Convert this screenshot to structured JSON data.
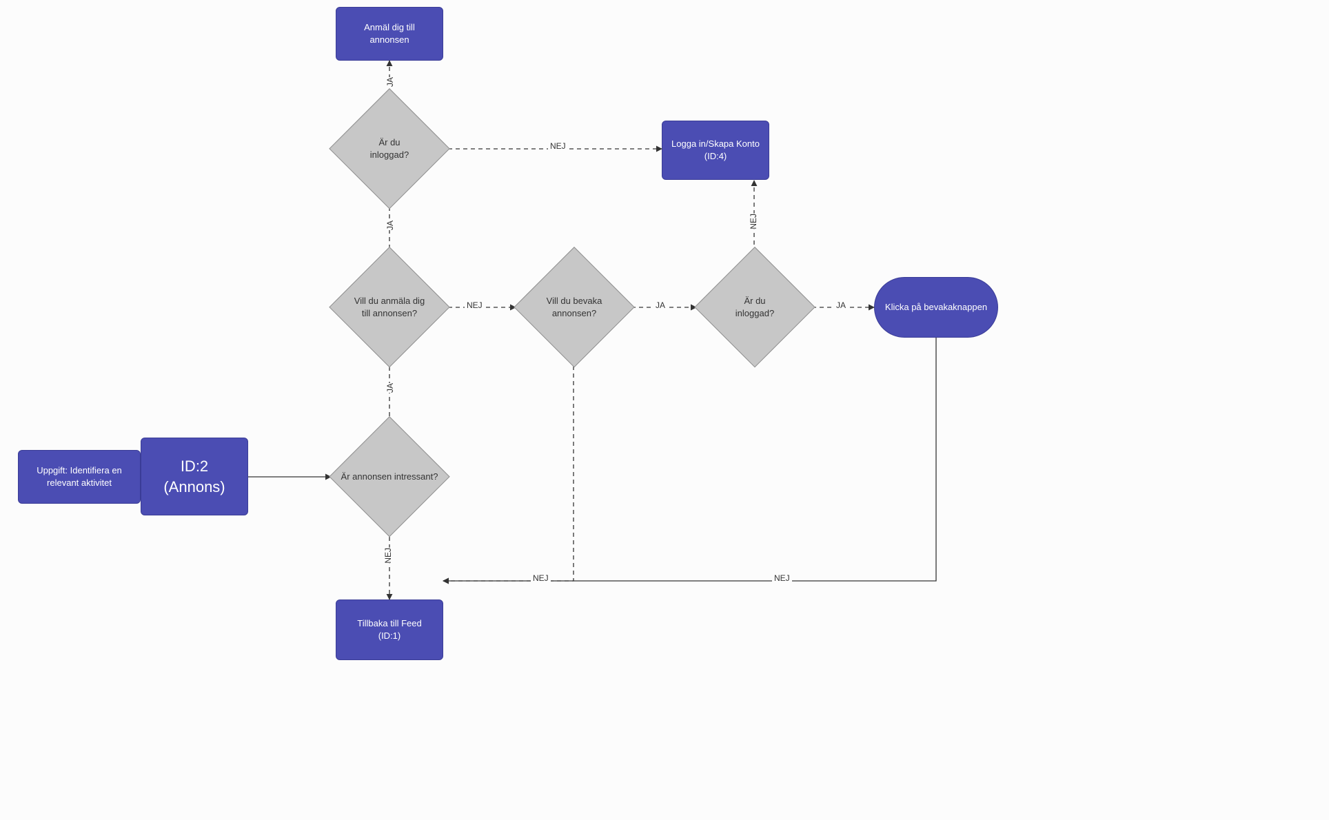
{
  "colors": {
    "node": "#4b4db3",
    "decision": "#c7c7c7",
    "text_on_node": "#ffffff",
    "text_on_decision": "#333333"
  },
  "labels": {
    "ja": "JA",
    "nej": "NEJ"
  },
  "nodes": {
    "task": {
      "text": "Uppgift: Identifiera en relevant aktivitet"
    },
    "id2": {
      "text": "ID:2\n(Annons)"
    },
    "d_interest": {
      "text": "Är annonsen intressant?"
    },
    "d_apply": {
      "text": "Vill du anmäla dig till annonsen?"
    },
    "d_follow": {
      "text": "Vill du bevaka annonsen?"
    },
    "d_login1": {
      "text": "Är du inloggad?"
    },
    "d_login2": {
      "text": "Är du inloggad?"
    },
    "p_apply": {
      "text": "Anmäl dig till annonsen"
    },
    "p_login": {
      "text": "Logga in/Skapa Konto\n(ID:4)"
    },
    "p_back": {
      "text": "Tillbaka till Feed\n(ID:1)"
    },
    "p_watch": {
      "text": "Klicka på bevakaknappen"
    }
  }
}
